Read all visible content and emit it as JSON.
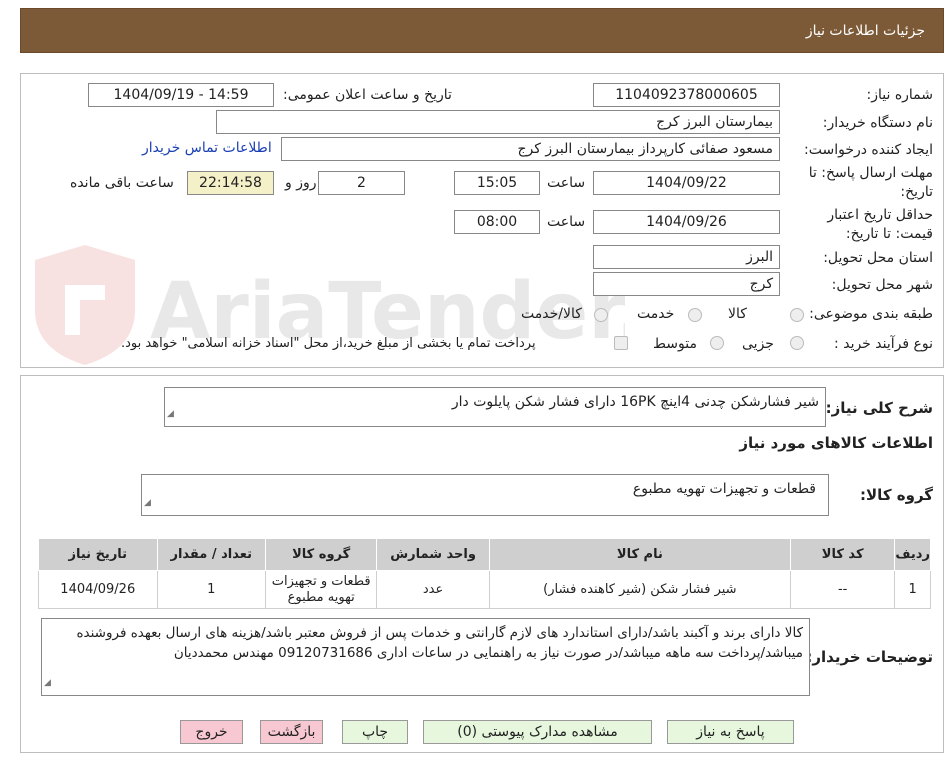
{
  "header": {
    "title": "جزئیات اطلاعات نیاز"
  },
  "watermark": {
    "text": "AriaTender.neT"
  },
  "fields": {
    "need_number_label": "شماره نیاز:",
    "need_number": "1104092378000605",
    "announce_label": "تاریخ و ساعت اعلان عمومی:",
    "announce_value": "1404/09/19 - 14:59",
    "buyer_org_label": "نام دستگاه خریدار:",
    "buyer_org": "بیمارستان البرز کرج",
    "creator_label": "ایجاد کننده درخواست:",
    "creator": "مسعود صفائی کارپرداز بیمارستان البرز کرج",
    "contact_link": "اطلاعات تماس خریدار",
    "deadline_label_1": "مهلت ارسال پاسخ: تا",
    "deadline_label_2": "تاریخ:",
    "deadline_date": "1404/09/22",
    "time_label": "ساعت",
    "deadline_time": "15:05",
    "days_value": "2",
    "days_label": "روز و",
    "remaining_time": "22:14:58",
    "remaining_label": "ساعت باقی مانده",
    "validity_label_1": "حداقل تاریخ اعتبار",
    "validity_label_2": "قیمت: تا تاریخ:",
    "validity_date": "1404/09/26",
    "validity_time": "08:00",
    "province_label": "استان محل تحویل:",
    "province": "البرز",
    "city_label": "شهر محل تحویل:",
    "city": "کرج",
    "category_label": "طبقه بندی موضوعی:",
    "cat_goods": "کالا",
    "cat_service": "خدمت",
    "cat_goods_service": "کالا/خدمت",
    "process_label": "نوع فرآیند خرید :",
    "proc_partial": "جزیی",
    "proc_medium": "متوسط",
    "payment_note": "پرداخت تمام یا بخشی از مبلغ خرید،از محل \"اسناد خزانه اسلامی\" خواهد بود."
  },
  "summary": {
    "label": "شرح کلی نیاز:",
    "text": "شیر فشارشکن چدنی 4اینچ 16PK دارای فشار شکن پایلوت دار",
    "goods_info_title": "اطلاعات کالاهای مورد نیاز",
    "group_label": "گروه کالا:",
    "group_text": "قطعات و تجهیزات تهویه مطبوع"
  },
  "table": {
    "headers": [
      "ردیف",
      "کد کالا",
      "نام کالا",
      "واحد شمارش",
      "گروه کالا",
      "تعداد / مقدار",
      "تاریخ نیاز"
    ],
    "rows": [
      [
        "1",
        "--",
        "شیر فشار شکن (شیر کاهنده فشار)",
        "عدد",
        "قطعات و تجهیزات تهویه مطبوع",
        "1",
        "1404/09/26"
      ]
    ]
  },
  "notes": {
    "label": "توضیحات خریدار:",
    "text": "کالا دارای برند و آکبند باشد/دارای استاندارد های لازم گارانتی و خدمات پس از فروش معتبر باشد/هزینه های ارسال بعهده فروشنده میباشد/پرداخت سه ماهه میباشد/در صورت نیاز به راهنمایی در ساعات اداری 09120731686 مهندس محمددیان"
  },
  "buttons": {
    "reply": "پاسخ به نیاز",
    "attachments": "مشاهده مدارک پیوستی (0)",
    "print": "چاپ",
    "back": "بازگشت",
    "exit": "خروج"
  },
  "colors": {
    "header_bg": "#7d5a37",
    "link": "#1a3fb5",
    "highlight": "#f4f1c9",
    "button_green": "#e6f7de",
    "button_pink": "#f7c8d2"
  }
}
